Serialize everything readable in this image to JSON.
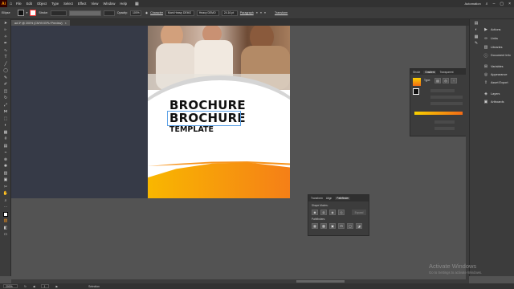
{
  "app": {
    "logo": "Ai"
  },
  "menu": [
    "File",
    "Edit",
    "Object",
    "Type",
    "Select",
    "Effect",
    "View",
    "Window",
    "Help"
  ],
  "menu_right": {
    "workspace": "Automation"
  },
  "control_bar": {
    "left_label": "Ellipse",
    "stroke_label": "Stroke:",
    "opacity_label": "Opacity:",
    "opacity_value": "100%",
    "character_label": "Character",
    "font_name": "Mont Heavy DEMO",
    "font_style": "Heavy DEMO",
    "font_size": "24.16 pt",
    "paragraph_label": "Paragraph",
    "transform_label": "Transform"
  },
  "document_tab": {
    "title": "ad 3* @ 200% (CMYK/GPU Preview)",
    "close": "×"
  },
  "artboard": {
    "title_line1": "BROCHURE",
    "title_line2": "BROCHURE",
    "subtitle": "TEMPLATE"
  },
  "right_panels": [
    {
      "icon": "actions-icon",
      "label": "Actions"
    },
    {
      "icon": "links-icon",
      "label": "Links"
    },
    {
      "icon": "libraries-icon",
      "label": "Libraries"
    },
    {
      "icon": "document-info-icon",
      "label": "Document Info"
    },
    {
      "icon": "variables-icon",
      "label": "Variables"
    },
    {
      "icon": "appearance-icon",
      "label": "Appearance"
    },
    {
      "icon": "asset-export-icon",
      "label": "Asset Export"
    },
    {
      "icon": "layers-icon",
      "label": "Layers"
    },
    {
      "icon": "artboards-icon",
      "label": "Artboards"
    }
  ],
  "gradient_panel": {
    "tabs": [
      "Stroke",
      "Gradient",
      "Transparent"
    ],
    "active": "Gradient",
    "type_label": "Type:"
  },
  "pathfinder_panel": {
    "tabs": [
      "Transform",
      "Align",
      "Pathfinder"
    ],
    "active": "Pathfinder",
    "shape_modes_label": "Shape Modes:",
    "pathfinders_label": "Pathfinders:",
    "expand_label": "Expand"
  },
  "status_bar": {
    "zoom": "200%",
    "page": "1",
    "tool": "Selection"
  },
  "watermark": {
    "line1": "Activate Windows",
    "line2": "Go to Settings to activate Windows."
  },
  "colors": {
    "accent_orange": "#f7941d",
    "accent_yellow": "#f9b700",
    "artboard_dark": "#363a47"
  }
}
